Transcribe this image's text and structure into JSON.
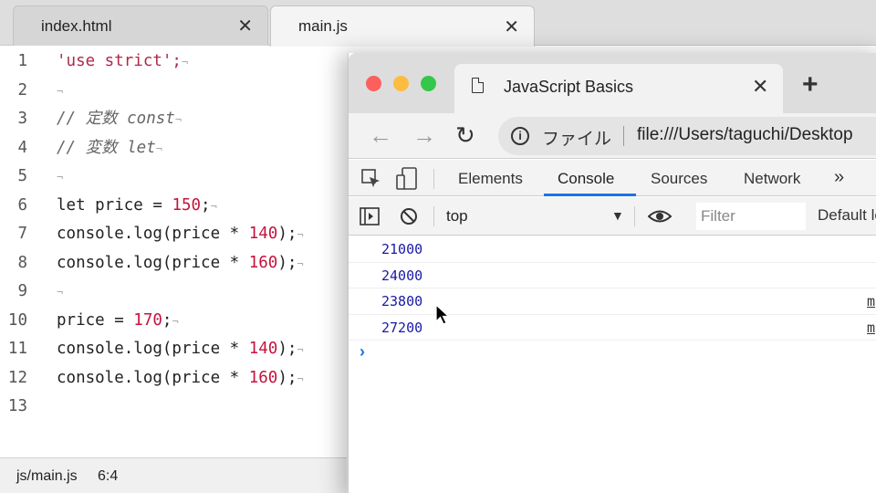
{
  "editor": {
    "tabs": [
      {
        "label": "index.html",
        "active": false
      },
      {
        "label": "main.js",
        "active": true
      }
    ],
    "line_numbers": [
      "1",
      "2",
      "3",
      "4",
      "5",
      "6",
      "7",
      "8",
      "9",
      "10",
      "11",
      "12",
      "13"
    ],
    "code": {
      "l1": "'use strict';",
      "l3_comment": "// 定数 const",
      "l4_comment": "// 変数 let",
      "l6_a": "let price = ",
      "l6_num": "150",
      "l6_end": ";",
      "log_open": "console.log(price * ",
      "n140": "140",
      "n160": "160",
      "log_close": ");",
      "l10_a": "price = ",
      "l10_num": "170",
      "l10_end": ";",
      "eol_marker": "¬"
    },
    "status": {
      "file": "js/main.js",
      "position": "6:4"
    }
  },
  "browser": {
    "tab_title": "JavaScript Basics",
    "omnibox_label": "ファイル",
    "url": "file:///Users/taguchi/Desktop",
    "devtools_tabs": [
      "Elements",
      "Console",
      "Sources",
      "Network",
      "»"
    ],
    "active_tab": "Console",
    "context": "top",
    "filter_placeholder": "Filter",
    "levels_label": "Default levels",
    "console_rows": [
      {
        "value": "21000",
        "source": ""
      },
      {
        "value": "24000",
        "source": ""
      },
      {
        "value": "23800",
        "source": "m"
      },
      {
        "value": "27200",
        "source": "m"
      }
    ],
    "prompt": "›"
  },
  "colors": {
    "string": "#b0284b",
    "number": "#c4143c",
    "console_value": "#1a1aa6",
    "accent": "#1a73e8",
    "traffic_red": "#fc605c",
    "traffic_yellow": "#fdbc40",
    "traffic_green": "#34c84a"
  }
}
